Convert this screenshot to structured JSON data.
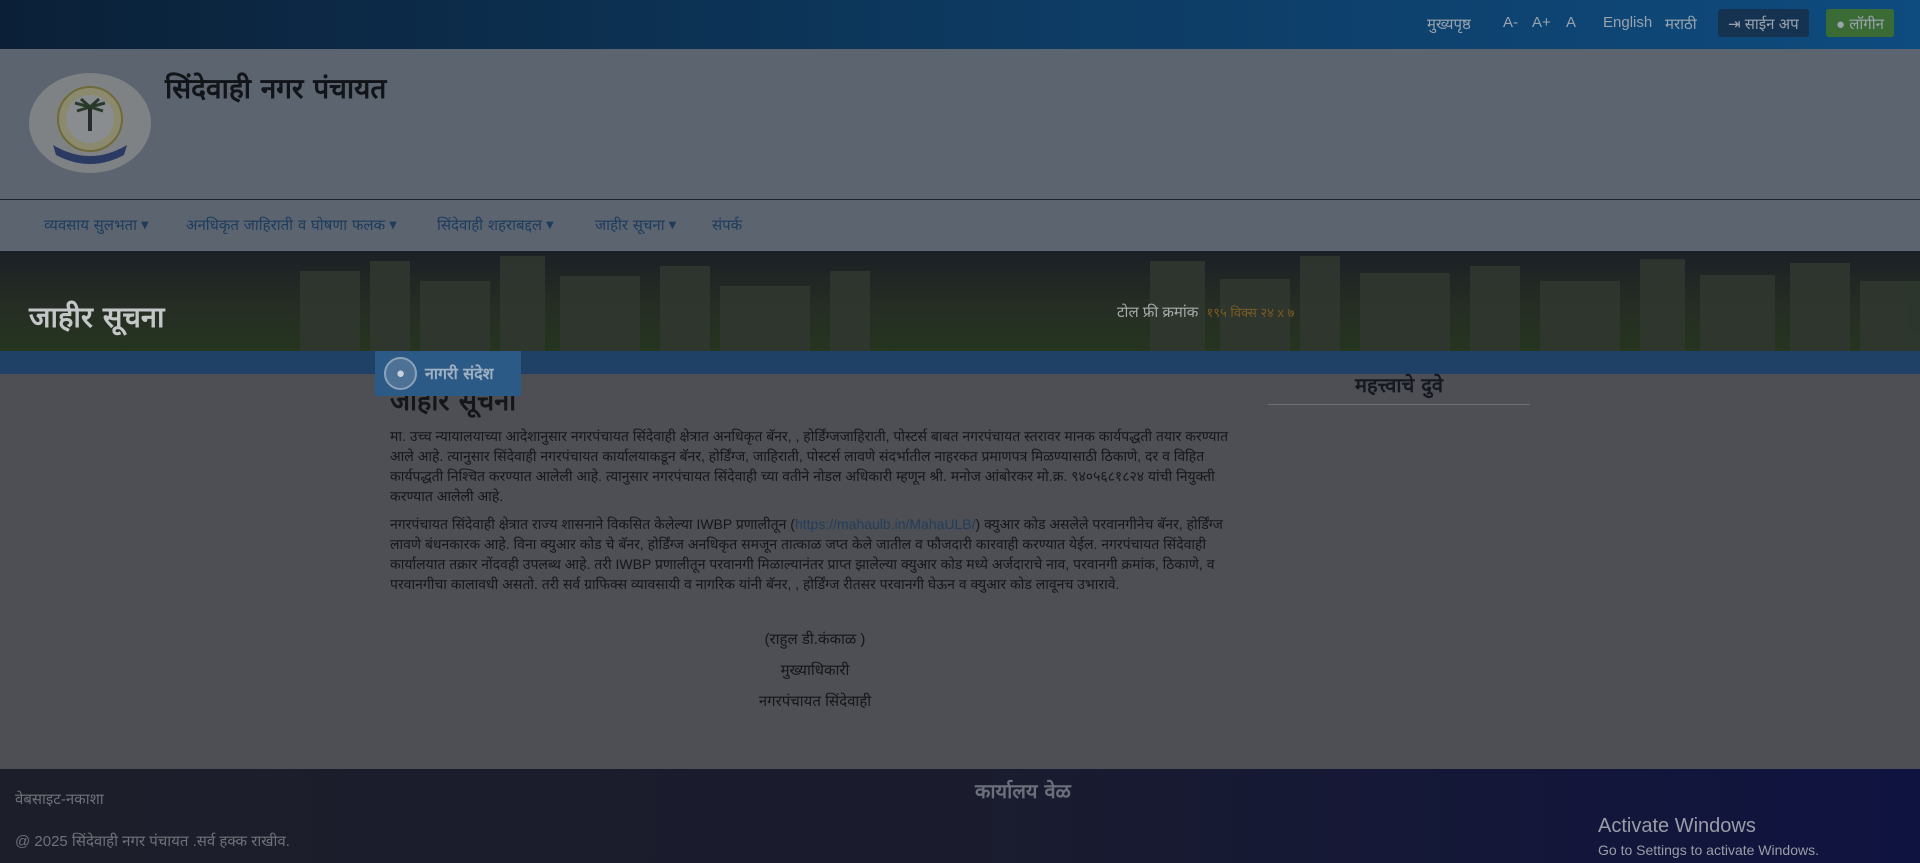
{
  "topbar": {
    "home": "मुख्यपृष्ठ",
    "font_decrease": "A-",
    "font_increase": "A+",
    "font_reset": "A",
    "lang_english": "English",
    "lang_marathi": "मराठी",
    "signup": "साईन अप",
    "login": "लॉगीन",
    "signup_icon": "sign-in-icon",
    "login_icon": "user-icon"
  },
  "header": {
    "site_title": "सिंदेवाही नगर पंचायत"
  },
  "nav": {
    "items": [
      {
        "label": "व्यवसाय सुलभता",
        "dropdown": true
      },
      {
        "label": "अनधिकृत जाहिराती व घोषणा फलक",
        "dropdown": true
      },
      {
        "label": "सिंदेवाही शहराबद्दल",
        "dropdown": true
      },
      {
        "label": "जाहीर सूचना",
        "dropdown": true
      },
      {
        "label": "संपर्क",
        "dropdown": false
      }
    ]
  },
  "banner": {
    "title": "जाहीर सूचना",
    "tollfree_label": "टोल फ्री क्रमांक",
    "tollfree_number": "१९५ विक्स २४ x ७"
  },
  "main": {
    "tag_label": "नागरी संदेश",
    "tag_icon": "users-icon",
    "article_title": "जाहीर सूचना",
    "para1": "मा. उच्च न्यायालयाच्या आदेशानुसार नगरपंचायत सिंदेवाही क्षेत्रात अनधिकृत बॅनर, , होर्डिंग्जजाहिराती, पोस्टर्स बाबत नगरपंचायत स्तरावर मानक कार्यपद्धती तयार करण्यात आले आहे. त्यानुसार सिंदेवाही नगरपंचायत कार्यालयाकडून बॅनर, होर्डिंग्ज, जाहिराती, पोस्टर्स लावणे संदर्भातील नाहरकत प्रमाणपत्र मिळण्यासाठी ठिकाणे, दर व विहित कार्यपद्धती निश्चित करण्यात आलेली आहे. त्यानुसार नगरपंचायत सिंदेवाही च्या वतीने नोडल अधिकारी म्हणून श्री. मनोज आंबोरकर मो.क्र. ९४०५६८१८२४ यांची नियुक्ती करण्यात आलेली आहे.",
    "para2_before": "नगरपंचायत सिंदेवाही क्षेत्रात राज्य शासनाने विकसित केलेल्या IWBP प्रणालीतून (",
    "para2_link": "https://mahaulb.in/MahaULB/",
    "para2_after": ") क्युआर कोड असलेले परवानगीनेच बॅनर, होर्डिंग्ज लावणे बंधनकारक आहे. विना क्युआर कोड चे बॅनर, होर्डिंग्ज अनधिकृत समजून तात्काळ जप्त केले जातील व फौजदारी कारवाही करण्यात येईल. नगरपंचायत सिंदेवाही कार्यालयात तक्रार नोंदवही उपलब्ध आहे. तरी IWBP प्रणालीतून परवानगी मिळाल्यानंतर प्राप्त झालेल्या क्युआर कोड मध्ये अर्जदाराचे नाव, परवानगी क्रमांक, ठिकाणे, व परवानगीचा कालावधी असतो. तरी सर्व ग्राफिक्स व्यावसायी व नागरिक यांनी बॅनर, , होर्डिंग्ज रीतसर परवानगी घेऊन व क्युआर कोड लावूनच उभारावे.",
    "sign_name": "(राहुल डी.कंकाळ )",
    "sign_designation": "मुख्याधिकारी",
    "sign_office": "नगरपंचायत सिंदेवाही"
  },
  "sidebar": {
    "title": "महत्त्वाचे दुवे"
  },
  "footer": {
    "sitemap": "वेबसाइट-नकाशा",
    "copyright": "@ 2025 सिंदेवाही नगर पंचायत .सर्व हक्क राखीव.",
    "office_hours_title": "कार्यालय वेळ"
  },
  "windows_watermark": {
    "title": "Activate Windows",
    "subtitle": "Go to Settings to activate Windows."
  },
  "colors": {
    "topbar": "#0d3b63",
    "header_bg": "#5c6470",
    "stripe": "#1f4166",
    "tag_bg": "#2b5a86",
    "footer": "#1a1c2e"
  }
}
